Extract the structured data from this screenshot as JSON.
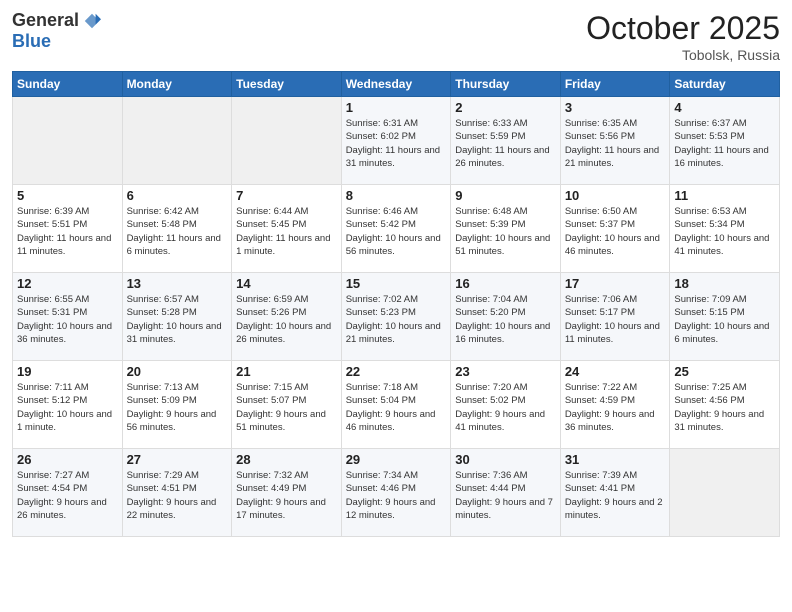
{
  "header": {
    "logo_general": "General",
    "logo_blue": "Blue",
    "month": "October 2025",
    "location": "Tobolsk, Russia"
  },
  "weekdays": [
    "Sunday",
    "Monday",
    "Tuesday",
    "Wednesday",
    "Thursday",
    "Friday",
    "Saturday"
  ],
  "weeks": [
    [
      {
        "day": "",
        "info": ""
      },
      {
        "day": "",
        "info": ""
      },
      {
        "day": "",
        "info": ""
      },
      {
        "day": "1",
        "info": "Sunrise: 6:31 AM\nSunset: 6:02 PM\nDaylight: 11 hours\nand 31 minutes."
      },
      {
        "day": "2",
        "info": "Sunrise: 6:33 AM\nSunset: 5:59 PM\nDaylight: 11 hours\nand 26 minutes."
      },
      {
        "day": "3",
        "info": "Sunrise: 6:35 AM\nSunset: 5:56 PM\nDaylight: 11 hours\nand 21 minutes."
      },
      {
        "day": "4",
        "info": "Sunrise: 6:37 AM\nSunset: 5:53 PM\nDaylight: 11 hours\nand 16 minutes."
      }
    ],
    [
      {
        "day": "5",
        "info": "Sunrise: 6:39 AM\nSunset: 5:51 PM\nDaylight: 11 hours\nand 11 minutes."
      },
      {
        "day": "6",
        "info": "Sunrise: 6:42 AM\nSunset: 5:48 PM\nDaylight: 11 hours\nand 6 minutes."
      },
      {
        "day": "7",
        "info": "Sunrise: 6:44 AM\nSunset: 5:45 PM\nDaylight: 11 hours\nand 1 minute."
      },
      {
        "day": "8",
        "info": "Sunrise: 6:46 AM\nSunset: 5:42 PM\nDaylight: 10 hours\nand 56 minutes."
      },
      {
        "day": "9",
        "info": "Sunrise: 6:48 AM\nSunset: 5:39 PM\nDaylight: 10 hours\nand 51 minutes."
      },
      {
        "day": "10",
        "info": "Sunrise: 6:50 AM\nSunset: 5:37 PM\nDaylight: 10 hours\nand 46 minutes."
      },
      {
        "day": "11",
        "info": "Sunrise: 6:53 AM\nSunset: 5:34 PM\nDaylight: 10 hours\nand 41 minutes."
      }
    ],
    [
      {
        "day": "12",
        "info": "Sunrise: 6:55 AM\nSunset: 5:31 PM\nDaylight: 10 hours\nand 36 minutes."
      },
      {
        "day": "13",
        "info": "Sunrise: 6:57 AM\nSunset: 5:28 PM\nDaylight: 10 hours\nand 31 minutes."
      },
      {
        "day": "14",
        "info": "Sunrise: 6:59 AM\nSunset: 5:26 PM\nDaylight: 10 hours\nand 26 minutes."
      },
      {
        "day": "15",
        "info": "Sunrise: 7:02 AM\nSunset: 5:23 PM\nDaylight: 10 hours\nand 21 minutes."
      },
      {
        "day": "16",
        "info": "Sunrise: 7:04 AM\nSunset: 5:20 PM\nDaylight: 10 hours\nand 16 minutes."
      },
      {
        "day": "17",
        "info": "Sunrise: 7:06 AM\nSunset: 5:17 PM\nDaylight: 10 hours\nand 11 minutes."
      },
      {
        "day": "18",
        "info": "Sunrise: 7:09 AM\nSunset: 5:15 PM\nDaylight: 10 hours\nand 6 minutes."
      }
    ],
    [
      {
        "day": "19",
        "info": "Sunrise: 7:11 AM\nSunset: 5:12 PM\nDaylight: 10 hours\nand 1 minute."
      },
      {
        "day": "20",
        "info": "Sunrise: 7:13 AM\nSunset: 5:09 PM\nDaylight: 9 hours\nand 56 minutes."
      },
      {
        "day": "21",
        "info": "Sunrise: 7:15 AM\nSunset: 5:07 PM\nDaylight: 9 hours\nand 51 minutes."
      },
      {
        "day": "22",
        "info": "Sunrise: 7:18 AM\nSunset: 5:04 PM\nDaylight: 9 hours\nand 46 minutes."
      },
      {
        "day": "23",
        "info": "Sunrise: 7:20 AM\nSunset: 5:02 PM\nDaylight: 9 hours\nand 41 minutes."
      },
      {
        "day": "24",
        "info": "Sunrise: 7:22 AM\nSunset: 4:59 PM\nDaylight: 9 hours\nand 36 minutes."
      },
      {
        "day": "25",
        "info": "Sunrise: 7:25 AM\nSunset: 4:56 PM\nDaylight: 9 hours\nand 31 minutes."
      }
    ],
    [
      {
        "day": "26",
        "info": "Sunrise: 7:27 AM\nSunset: 4:54 PM\nDaylight: 9 hours\nand 26 minutes."
      },
      {
        "day": "27",
        "info": "Sunrise: 7:29 AM\nSunset: 4:51 PM\nDaylight: 9 hours\nand 22 minutes."
      },
      {
        "day": "28",
        "info": "Sunrise: 7:32 AM\nSunset: 4:49 PM\nDaylight: 9 hours\nand 17 minutes."
      },
      {
        "day": "29",
        "info": "Sunrise: 7:34 AM\nSunset: 4:46 PM\nDaylight: 9 hours\nand 12 minutes."
      },
      {
        "day": "30",
        "info": "Sunrise: 7:36 AM\nSunset: 4:44 PM\nDaylight: 9 hours\nand 7 minutes."
      },
      {
        "day": "31",
        "info": "Sunrise: 7:39 AM\nSunset: 4:41 PM\nDaylight: 9 hours\nand 2 minutes."
      },
      {
        "day": "",
        "info": ""
      }
    ]
  ]
}
